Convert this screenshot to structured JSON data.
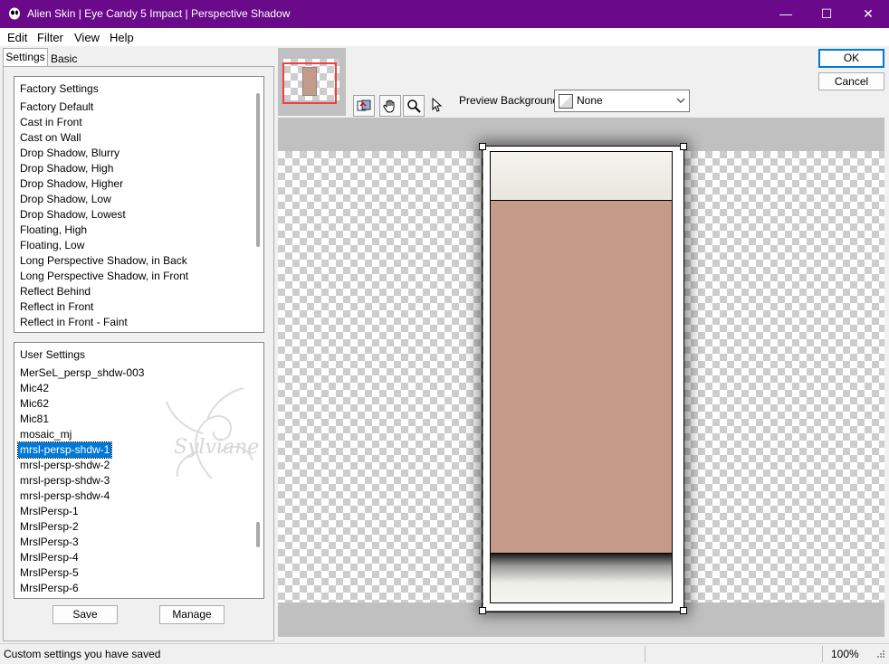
{
  "window": {
    "title": "Alien Skin | Eye Candy 5 Impact | Perspective Shadow",
    "minimize_glyph": "—",
    "maximize_glyph": "☐",
    "close_glyph": "✕"
  },
  "menu": [
    "Edit",
    "Filter",
    "View",
    "Help"
  ],
  "tabs": {
    "settings": "Settings",
    "basic": "Basic"
  },
  "factory_settings": {
    "header": "Factory Settings",
    "items": [
      "Factory Default",
      "Cast in Front",
      "Cast on Wall",
      "Drop Shadow, Blurry",
      "Drop Shadow, High",
      "Drop Shadow, Higher",
      "Drop Shadow, Low",
      "Drop Shadow, Lowest",
      "Floating, High",
      "Floating, Low",
      "Long Perspective Shadow, in Back",
      "Long Perspective Shadow, in Front",
      "Reflect Behind",
      "Reflect in Front",
      "Reflect in Front - Faint"
    ]
  },
  "user_settings": {
    "header": "User Settings",
    "selected": "mrsl-persp-shdw-1",
    "items": [
      "MerSeL_persp_shdw-003",
      "Mic42",
      "Mic62",
      "Mic81",
      "mosaic_mj",
      "mrsl-persp-shdw-1",
      "mrsl-persp-shdw-2",
      "mrsl-persp-shdw-3",
      "mrsl-persp-shdw-4",
      "MrslPersp-1",
      "MrslPersp-2",
      "MrslPersp-3",
      "MrslPersp-4",
      "MrslPersp-5",
      "MrslPersp-6"
    ]
  },
  "left_buttons": {
    "save": "Save",
    "manage": "Manage"
  },
  "dialog_buttons": {
    "ok": "OK",
    "cancel": "Cancel"
  },
  "preview": {
    "background_label": "Preview Background:",
    "background_value": "None",
    "tools": [
      "swap-preview-icon",
      "hand-pan-icon",
      "zoom-magnifier-icon",
      "pointer-arrow-icon"
    ]
  },
  "watermark": "Sylviane",
  "status": {
    "message": "Custom settings you have saved",
    "zoom": "100%"
  },
  "colors": {
    "titlebar": "#6a0a8a",
    "selection": "#0078d7",
    "tan_fill": "#c49a88",
    "cream": "#eeeee8"
  }
}
